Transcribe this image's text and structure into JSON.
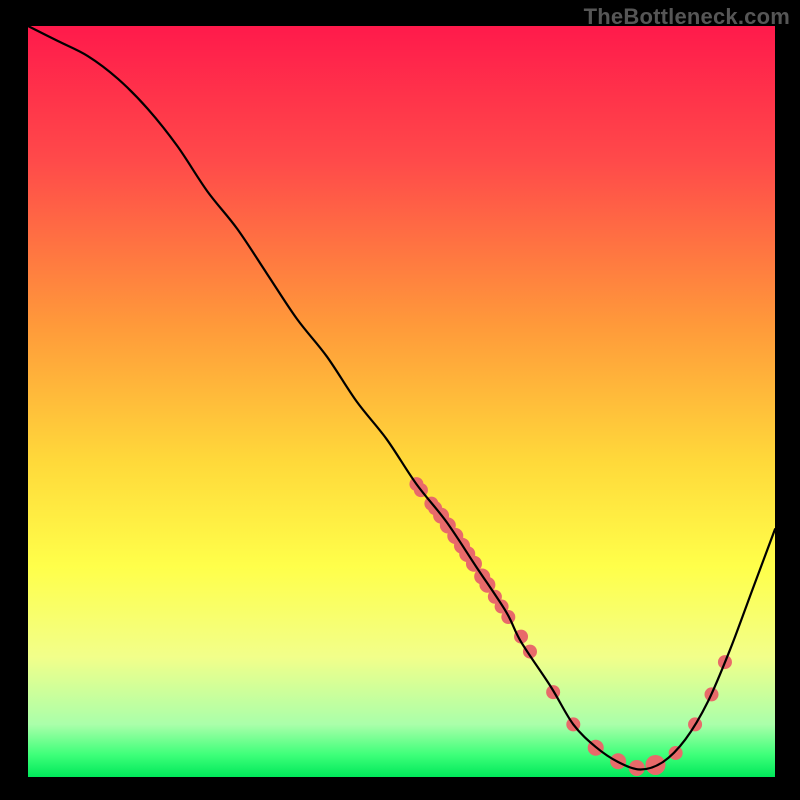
{
  "watermark": "TheBottleneck.com",
  "chart_data": {
    "type": "line",
    "title": "",
    "xlabel": "",
    "ylabel": "",
    "xlim": [
      0,
      100
    ],
    "ylim": [
      0,
      100
    ],
    "gradient_stops": [
      {
        "offset": 0,
        "color": "#ff1a4b"
      },
      {
        "offset": 18,
        "color": "#ff4a4a"
      },
      {
        "offset": 40,
        "color": "#ff9a3a"
      },
      {
        "offset": 58,
        "color": "#ffd93a"
      },
      {
        "offset": 72,
        "color": "#ffff4a"
      },
      {
        "offset": 84,
        "color": "#f2ff8a"
      },
      {
        "offset": 93,
        "color": "#aaffaa"
      },
      {
        "offset": 97,
        "color": "#3fff7a"
      },
      {
        "offset": 100,
        "color": "#00e85a"
      }
    ],
    "series": [
      {
        "name": "curve",
        "x": [
          0,
          4,
          8,
          12,
          16,
          20,
          24,
          28,
          32,
          36,
          40,
          44,
          48,
          52,
          56,
          60,
          64,
          66,
          70,
          73,
          76,
          79,
          82,
          85,
          88,
          91,
          94,
          97,
          100
        ],
        "y": [
          100,
          98,
          96,
          93,
          89,
          84,
          78,
          73,
          67,
          61,
          56,
          50,
          45,
          39,
          34,
          28,
          22,
          18,
          12,
          7,
          4,
          2,
          1,
          2,
          5,
          10,
          17,
          25,
          33
        ]
      }
    ],
    "scatter": {
      "name": "highlight-points",
      "color": "#e86a6a",
      "points": [
        {
          "x": 52,
          "y": 39,
          "r": 7
        },
        {
          "x": 52.6,
          "y": 38.2,
          "r": 7
        },
        {
          "x": 54,
          "y": 36.4,
          "r": 7
        },
        {
          "x": 54.5,
          "y": 35.8,
          "r": 7
        },
        {
          "x": 55.3,
          "y": 34.8,
          "r": 8
        },
        {
          "x": 56.2,
          "y": 33.5,
          "r": 8
        },
        {
          "x": 57.2,
          "y": 32.1,
          "r": 8
        },
        {
          "x": 58.1,
          "y": 30.8,
          "r": 8
        },
        {
          "x": 58.8,
          "y": 29.7,
          "r": 8
        },
        {
          "x": 59.7,
          "y": 28.4,
          "r": 8
        },
        {
          "x": 60.8,
          "y": 26.7,
          "r": 8
        },
        {
          "x": 61.5,
          "y": 25.6,
          "r": 8
        },
        {
          "x": 62.5,
          "y": 24.0,
          "r": 7
        },
        {
          "x": 63.4,
          "y": 22.7,
          "r": 7
        },
        {
          "x": 64.3,
          "y": 21.3,
          "r": 7
        },
        {
          "x": 66.0,
          "y": 18.7,
          "r": 7
        },
        {
          "x": 67.2,
          "y": 16.7,
          "r": 7
        },
        {
          "x": 70.3,
          "y": 11.3,
          "r": 7
        },
        {
          "x": 73.0,
          "y": 7.0,
          "r": 7
        },
        {
          "x": 76.0,
          "y": 3.9,
          "r": 8
        },
        {
          "x": 79.0,
          "y": 2.1,
          "r": 8
        },
        {
          "x": 81.5,
          "y": 1.2,
          "r": 8
        },
        {
          "x": 84.0,
          "y": 1.6,
          "r": 10
        },
        {
          "x": 86.7,
          "y": 3.2,
          "r": 7
        },
        {
          "x": 89.3,
          "y": 7.0,
          "r": 7
        },
        {
          "x": 91.5,
          "y": 11.0,
          "r": 7
        },
        {
          "x": 93.3,
          "y": 15.3,
          "r": 7
        }
      ]
    }
  }
}
